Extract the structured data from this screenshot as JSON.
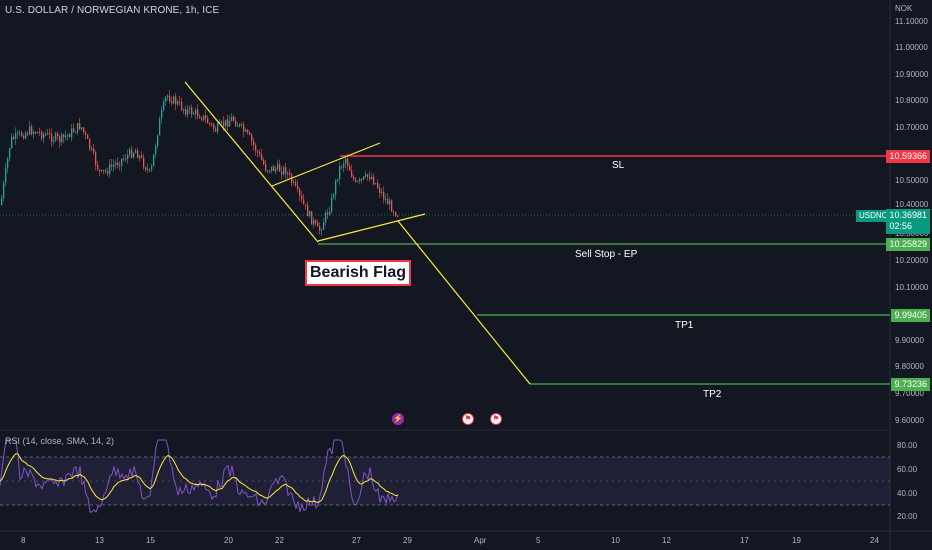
{
  "header": {
    "title": "U.S. DOLLAR / NORWEGIAN KRONE, 1h, ICE",
    "currency": "NOK"
  },
  "price_axis": {
    "labels": [
      "11.10000",
      "11.00000",
      "10.90000",
      "10.80000",
      "10.70000",
      "10.50000",
      "10.40000",
      "10.30000",
      "10.20000",
      "10.10000",
      "9.90000",
      "9.80000",
      "9.70000",
      "9.60000"
    ],
    "tags": {
      "sl": "10.59366",
      "current_symbol": "USDNOK",
      "current_price": "10.36981",
      "countdown": "02:56",
      "entry": "10.25829",
      "tp1": "9.99405",
      "tp2": "9.73236"
    }
  },
  "annotations": {
    "sl": "SL",
    "entry": "Sell Stop - EP",
    "tp1": "TP1",
    "tp2": "TP2",
    "pattern": "Bearish Flag"
  },
  "time_axis": {
    "labels": [
      "8",
      "13",
      "15",
      "20",
      "22",
      "27",
      "29",
      "Apr",
      "5",
      "10",
      "12",
      "17",
      "19",
      "24"
    ]
  },
  "rsi": {
    "title": "RSI (14, close, SMA, 14, 2)",
    "labels": [
      "80.00",
      "60.00",
      "40.00",
      "20.00"
    ]
  },
  "events": {
    "flash": "⚡",
    "flag": "⚑"
  },
  "colors": {
    "background": "#131722",
    "up": "#26a69a",
    "down": "#ef5350",
    "drawing": "#ffeb3b",
    "sl_line": "#f23645",
    "target_line": "#4caf50",
    "rsi_line": "#7e57c2",
    "rsi_sma": "#ffeb3b"
  },
  "chart_data": {
    "type": "candlestick",
    "symbol": "USDNOK",
    "timeframe": "1h",
    "ylim": [
      9.6,
      11.1
    ],
    "levels": {
      "sl": 10.59366,
      "current": 10.36981,
      "entry": 10.25829,
      "tp1": 9.99405,
      "tp2": 9.73236
    },
    "rsi_band": [
      70,
      30
    ]
  }
}
